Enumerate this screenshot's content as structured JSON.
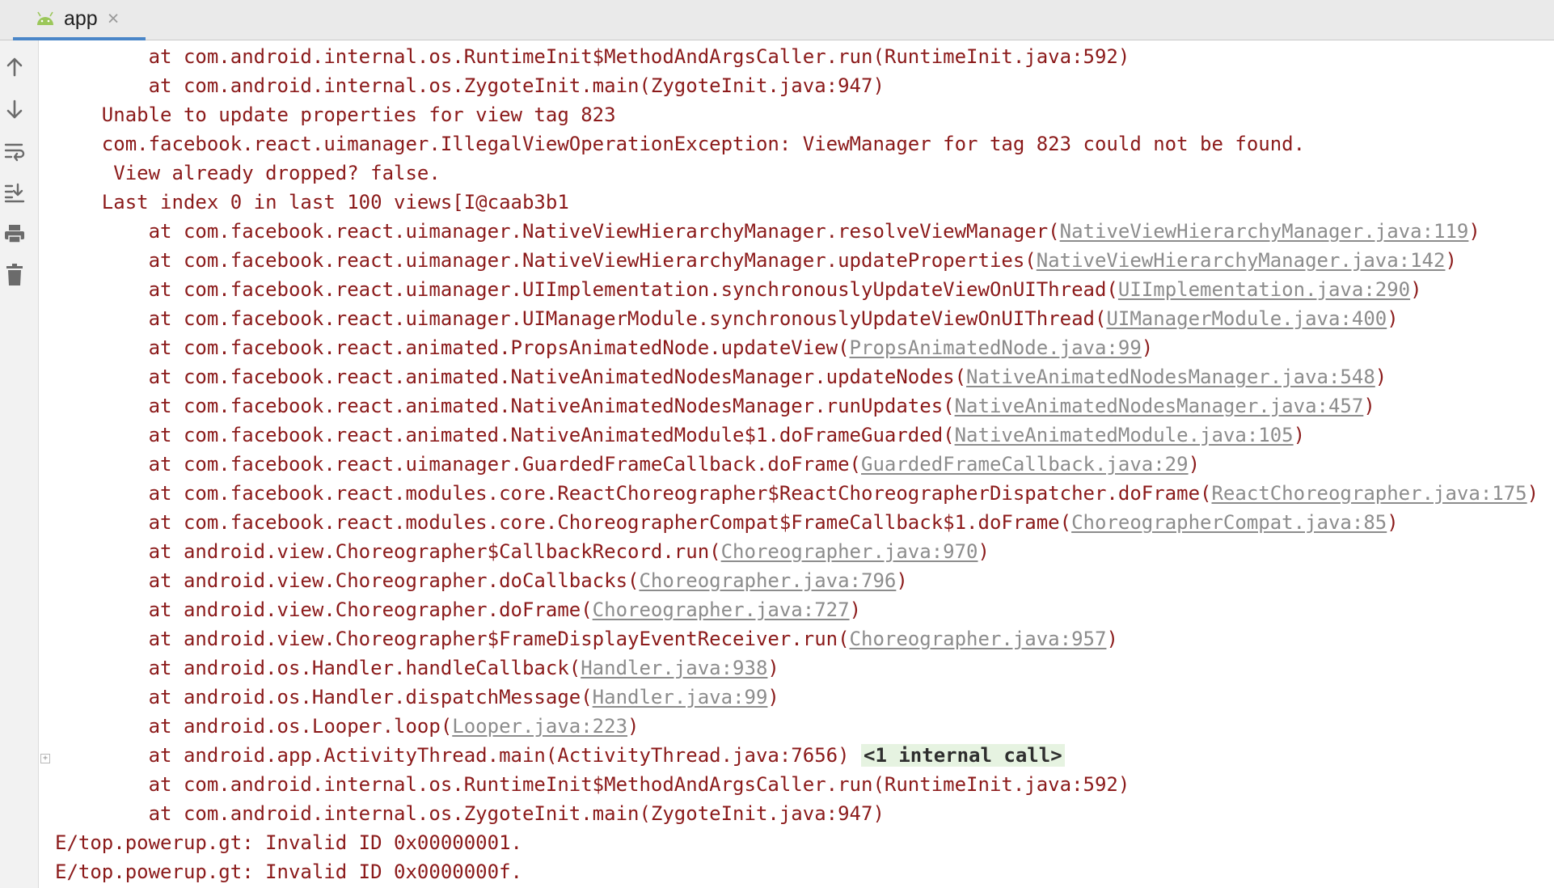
{
  "tab": {
    "icon": "android-icon",
    "title": "app",
    "close_icon": "close-icon"
  },
  "toolbar": [
    {
      "name": "up-arrow-icon",
      "label": "Up the stack trace"
    },
    {
      "name": "down-arrow-icon",
      "label": "Down the stack trace"
    },
    {
      "name": "soft-wrap-icon",
      "label": "Soft-wrap"
    },
    {
      "name": "scroll-to-end-icon",
      "label": "Scroll to the end"
    },
    {
      "name": "print-icon",
      "label": "Print"
    },
    {
      "name": "trash-icon",
      "label": "Clear all"
    }
  ],
  "colors": {
    "error_text": "#8b1a1a",
    "link_text": "#8c8c8c",
    "internal_call_bg": "#e6f3e1",
    "tab_underline": "#4a86c8"
  },
  "log": [
    {
      "text": "        at com.android.internal.os.RuntimeInit$MethodAndArgsCaller.run(RuntimeInit.java:592)"
    },
    {
      "text": "        at com.android.internal.os.ZygoteInit.main(ZygoteInit.java:947)"
    },
    {
      "text": "    Unable to update properties for view tag 823"
    },
    {
      "text": "    com.facebook.react.uimanager.IllegalViewOperationException: ViewManager for tag 823 could not be found."
    },
    {
      "text": "     View already dropped? false."
    },
    {
      "text": "    Last index 0 in last 100 views[I@caab3b1"
    },
    {
      "text": "        at com.facebook.react.uimanager.NativeViewHierarchyManager.resolveViewManager(",
      "link": "NativeViewHierarchyManager.java:119",
      "suffix": ")"
    },
    {
      "text": "        at com.facebook.react.uimanager.NativeViewHierarchyManager.updateProperties(",
      "link": "NativeViewHierarchyManager.java:142",
      "suffix": ")"
    },
    {
      "text": "        at com.facebook.react.uimanager.UIImplementation.synchronouslyUpdateViewOnUIThread(",
      "link": "UIImplementation.java:290",
      "suffix": ")"
    },
    {
      "text": "        at com.facebook.react.uimanager.UIManagerModule.synchronouslyUpdateViewOnUIThread(",
      "link": "UIManagerModule.java:400",
      "suffix": ")"
    },
    {
      "text": "        at com.facebook.react.animated.PropsAnimatedNode.updateView(",
      "link": "PropsAnimatedNode.java:99",
      "suffix": ")"
    },
    {
      "text": "        at com.facebook.react.animated.NativeAnimatedNodesManager.updateNodes(",
      "link": "NativeAnimatedNodesManager.java:548",
      "suffix": ")"
    },
    {
      "text": "        at com.facebook.react.animated.NativeAnimatedNodesManager.runUpdates(",
      "link": "NativeAnimatedNodesManager.java:457",
      "suffix": ")"
    },
    {
      "text": "        at com.facebook.react.animated.NativeAnimatedModule$1.doFrameGuarded(",
      "link": "NativeAnimatedModule.java:105",
      "suffix": ")"
    },
    {
      "text": "        at com.facebook.react.uimanager.GuardedFrameCallback.doFrame(",
      "link": "GuardedFrameCallback.java:29",
      "suffix": ")"
    },
    {
      "text": "        at com.facebook.react.modules.core.ReactChoreographer$ReactChoreographerDispatcher.doFrame(",
      "link": "ReactChoreographer.java:175",
      "suffix": ")"
    },
    {
      "text": "        at com.facebook.react.modules.core.ChoreographerCompat$FrameCallback$1.doFrame(",
      "link": "ChoreographerCompat.java:85",
      "suffix": ")"
    },
    {
      "text": "        at android.view.Choreographer$CallbackRecord.run(",
      "link": "Choreographer.java:970",
      "suffix": ")"
    },
    {
      "text": "        at android.view.Choreographer.doCallbacks(",
      "link": "Choreographer.java:796",
      "suffix": ")"
    },
    {
      "text": "        at android.view.Choreographer.doFrame(",
      "link": "Choreographer.java:727",
      "suffix": ")"
    },
    {
      "text": "        at android.view.Choreographer$FrameDisplayEventReceiver.run(",
      "link": "Choreographer.java:957",
      "suffix": ")"
    },
    {
      "text": "        at android.os.Handler.handleCallback(",
      "link": "Handler.java:938",
      "suffix": ")"
    },
    {
      "text": "        at android.os.Handler.dispatchMessage(",
      "link": "Handler.java:99",
      "suffix": ")"
    },
    {
      "text": "        at android.os.Looper.loop(",
      "link": "Looper.java:223",
      "suffix": ")"
    },
    {
      "text": "        at android.app.ActivityThread.main(ActivityThread.java:7656) ",
      "badge": "<1 internal call>",
      "fold": "+"
    },
    {
      "text": "        at com.android.internal.os.RuntimeInit$MethodAndArgsCaller.run(RuntimeInit.java:592)"
    },
    {
      "text": "        at com.android.internal.os.ZygoteInit.main(ZygoteInit.java:947)"
    },
    {
      "text": "E/top.powerup.gt: Invalid ID 0x00000001."
    },
    {
      "text": "E/top.powerup.gt: Invalid ID 0x0000000f."
    }
  ]
}
